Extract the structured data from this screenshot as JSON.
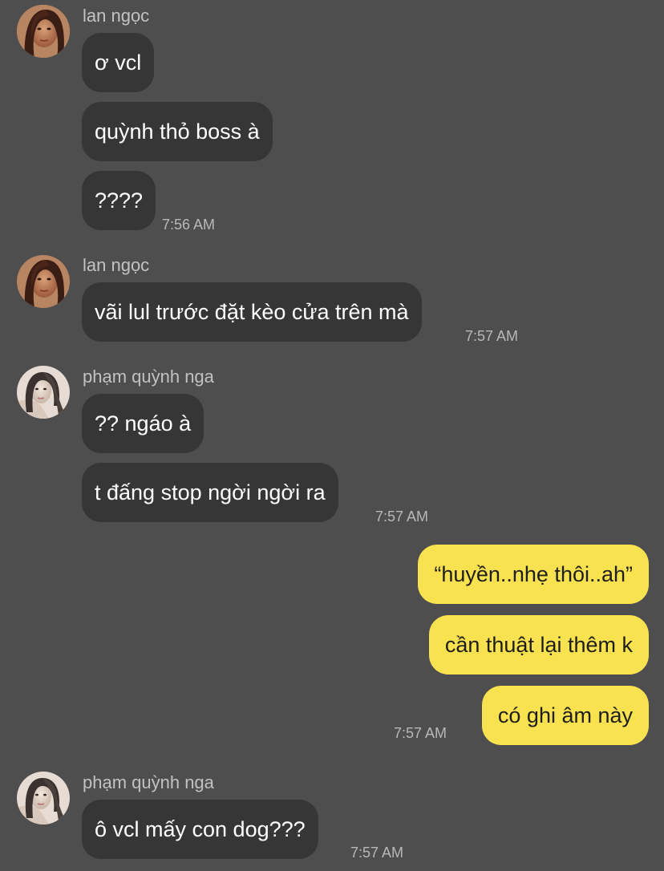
{
  "messages": [
    {
      "sender": "lan ngọc",
      "side": "left",
      "texts": [
        "ơ vcl",
        "quỳnh thỏ boss à",
        "????"
      ],
      "time": "7:56 AM"
    },
    {
      "sender": "lan ngọc",
      "side": "left",
      "texts": [
        "vãi lul trước đặt kèo cửa trên mà"
      ],
      "time": "7:57 AM"
    },
    {
      "sender": "phạm quỳnh nga",
      "side": "left",
      "texts": [
        "?? ngáo à",
        "t đấng stop ngời ngời ra"
      ],
      "time": "7:57 AM"
    },
    {
      "sender": "",
      "side": "right",
      "texts": [
        "“huyền..nhẹ thôi..ah”",
        "cần thuật lại thêm k",
        "có ghi âm này"
      ],
      "time": "7:57 AM"
    },
    {
      "sender": "phạm quỳnh nga",
      "side": "left",
      "texts": [
        "ô vcl mấy con dog???"
      ],
      "time": "7:57 AM"
    }
  ],
  "colors": {
    "background": "#4e4e4e",
    "incoming_bubble": "#363636",
    "outgoing_bubble": "#f9e24f",
    "incoming_text": "#ffffff",
    "outgoing_text": "#1e1e1e",
    "meta_text": "#c2c2c2"
  },
  "icons": {
    "lan_ngoc_avatar": "profile-photo",
    "pham_quynh_nga_avatar": "profile-photo"
  }
}
